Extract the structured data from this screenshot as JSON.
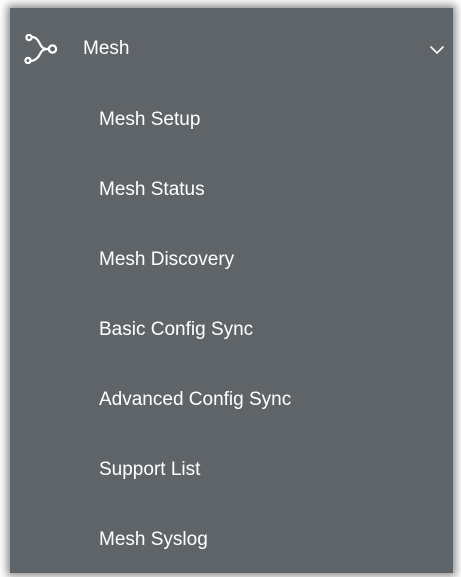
{
  "menu": {
    "header_label": "Mesh",
    "header_icon": "mesh-network-icon",
    "expand_icon": "chevron-down-icon",
    "colors": {
      "panel_background": "#5f6469",
      "text": "#ffffff"
    },
    "items": [
      {
        "label": "Mesh Setup"
      },
      {
        "label": "Mesh Status"
      },
      {
        "label": "Mesh Discovery"
      },
      {
        "label": "Basic Config Sync"
      },
      {
        "label": "Advanced Config Sync"
      },
      {
        "label": "Support List"
      },
      {
        "label": "Mesh Syslog"
      }
    ]
  }
}
